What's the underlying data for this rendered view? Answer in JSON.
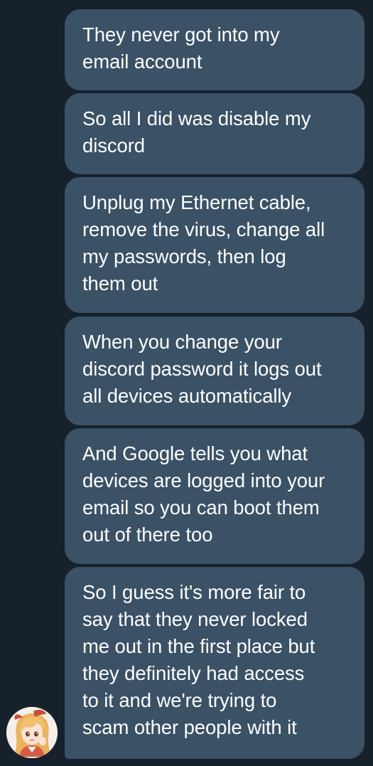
{
  "messages": [
    {
      "text": "They never got into my\nemail account"
    },
    {
      "text": "So all I did was disable my\ndiscord"
    },
    {
      "text": "Unplug my Ethernet cable,\nremove the virus, change all\nmy passwords, then log\nthem out"
    },
    {
      "text": "When you change your\ndiscord password it logs out\nall devices automatically"
    },
    {
      "text": "And Google tells you what\ndevices are logged into your\nemail so you can boot them\nout of there too"
    },
    {
      "text": "So I guess it's more fair to\nsay that they never locked\nme out in the first place but\nthey definitely had access\nto it and we're trying to\nscam other people with it"
    }
  ],
  "colors": {
    "background": "#17212b",
    "bubble": "#3a5166",
    "text": "#ffffff"
  },
  "sender": {
    "avatar_icon": "anime-character-avatar"
  }
}
